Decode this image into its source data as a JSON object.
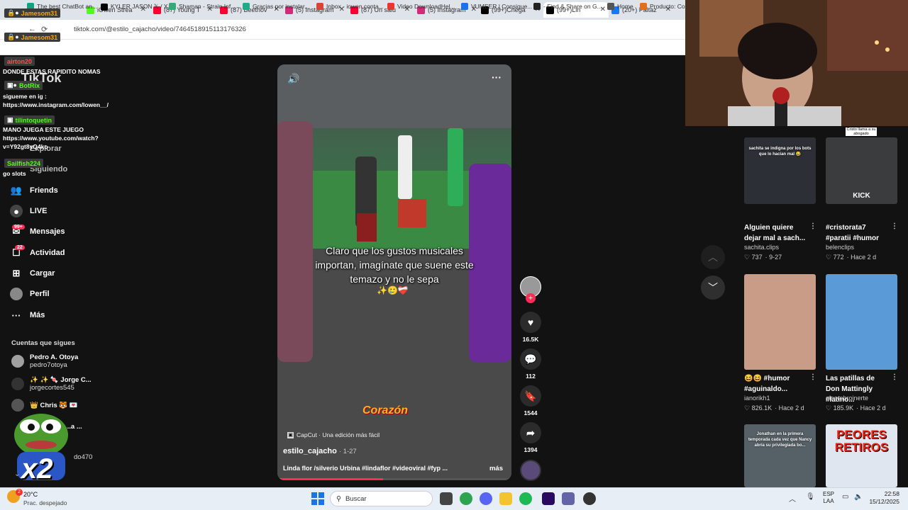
{
  "tabs": [
    {
      "label": "iOwen Strea",
      "color": "#53fc18"
    },
    {
      "label": "(87) Young T",
      "color": "#ff0033"
    },
    {
      "label": "(87) Beethov",
      "color": "#ff0033"
    },
    {
      "label": "(5) Instagram",
      "color": "#d62976"
    },
    {
      "label": "(87) Un salu",
      "color": "#ff0033"
    },
    {
      "label": "(5) Instagram",
      "color": "#d62976"
    },
    {
      "label": "(99+)Chega",
      "color": "#000000"
    },
    {
      "label": "(99+)Lin",
      "color": "#000000"
    },
    {
      "label": "(20+) Paltaz",
      "color": "#1877f2"
    }
  ],
  "url": "tiktok.com/@estilo_cajacho/video/7464518915113176326",
  "bookmarks": [
    {
      "label": "The best ChatBot an..."
    },
    {
      "label": "KYLER JASON 𝕏 / X"
    },
    {
      "label": "Shaman - Strain Inf..."
    },
    {
      "label": "Gracias por instalar..."
    },
    {
      "label": "Inbox - iowen.conta..."
    },
    {
      "label": "Video DownloadHel..."
    },
    {
      "label": "VUMEER | Consigue..."
    },
    {
      "label": "- Find & Share on G..."
    },
    {
      "label": "Home"
    },
    {
      "label": "Producto: Coll"
    }
  ],
  "chat": [
    {
      "user": "Jamesom31",
      "color": "#ffa500"
    },
    {
      "user": "Jamesom31",
      "color": "#ffa500"
    },
    {
      "user": "airton20",
      "color": "#ff4d4d"
    },
    {
      "msg": "DONDE ESTAS RAPIDITO NOMAS"
    },
    {
      "user": "BotRix",
      "color": "#53fc18"
    },
    {
      "msg": "sigueme en ig : https://www.instagram.com/lowen__/"
    },
    {
      "user": "tilintoquetin",
      "color": "#53fc18"
    },
    {
      "msg": "MANO JUEGA ESTE JUEGO https://www.youtube.com/watch?v=Y92gt8yQ4ko"
    },
    {
      "user": "Sailfish224",
      "color": "#53fc18"
    },
    {
      "msg": "go slots"
    }
  ],
  "sidebar": {
    "logo": "TikTok",
    "explorar": "Explorar",
    "siguiendo": "Siguiendo",
    "items": [
      {
        "label": "Friends",
        "icon": "friends-icon"
      },
      {
        "label": "LIVE",
        "icon": "live-icon"
      },
      {
        "label": "Mensajes",
        "icon": "messages-icon",
        "badge": "99+"
      },
      {
        "label": "Actividad",
        "icon": "activity-icon",
        "badge": "22"
      },
      {
        "label": "Cargar",
        "icon": "upload-icon"
      },
      {
        "label": "Perfil",
        "icon": "profile-icon"
      },
      {
        "label": "Más",
        "icon": "more-icon"
      }
    ],
    "following_title": "Cuentas que sigues",
    "following": [
      {
        "name": "Pedro A. Otoya",
        "handle": "pedro7otoya"
      },
      {
        "name": "✨ ✨ 🍬 Jorge C...",
        "handle": "jorgecortes545"
      },
      {
        "name": "👑 Chris 🐯 💌",
        "handle": ""
      },
      {
        "name": "...a ...",
        "handle": "do470"
      }
    ],
    "overlay_x2": "x2"
  },
  "video": {
    "caption_overlay": "Claro que los gustos musicales importan, imagínate que suene este temazo y no le sepa",
    "caption_emojis": "✨🥲❤️‍🩹",
    "capcut": "CapCut · Una edición más fácil",
    "author": "estilo_cajacho",
    "date": "· 1-27",
    "description": "Linda flor /silverio Urbina #lindaflor #videoviral #fyp ...",
    "more": "más",
    "sticker_text": "Corazón",
    "progress": 0.45
  },
  "actions": [
    {
      "icon": "heart-icon",
      "count": "16.5K"
    },
    {
      "icon": "comment-icon",
      "count": "112"
    },
    {
      "icon": "bookmark-icon",
      "count": "1544"
    },
    {
      "icon": "share-icon",
      "count": "1394"
    }
  ],
  "webcam": {
    "sign": "Cristo llama a su abogado"
  },
  "recommended": [
    {
      "title": "Alguien quiere dejar mal a sach...",
      "user": "sachita.clips",
      "likes": "♡ 737",
      "date": "· 9-27",
      "thumb": "#2d2f36",
      "overlay": "sachita se indigna por los bots que lo hacían mal 😂"
    },
    {
      "title": "#cristorata7 #paratii #humor",
      "user": "belenclips",
      "likes": "♡ 772",
      "date": "· Hace 2 d",
      "thumb": "#3a3c3e",
      "overlay": "KICK"
    },
    {
      "title": "😆😆 #humor #aguinaldo...",
      "user": "ianorikh1",
      "likes": "♡ 826.1K",
      "date": "· Hace 2 d",
      "thumb": "#c89c86",
      "overlay": ""
    },
    {
      "title": "Las patillas de Don Mattingly #latino...",
      "user": "elcerebroinerte",
      "likes": "♡ 185.9K",
      "date": "· Hace 2 d",
      "thumb": "#5a9ad6",
      "overlay": ""
    },
    {
      "title": "",
      "user": "",
      "likes": "",
      "date": "",
      "thumb": "#556067",
      "overlay": "Jonathan en la primera temporada cada vez que Nancy abría su privilegiada bo..."
    },
    {
      "title": "",
      "user": "",
      "likes": "",
      "date": "",
      "thumb": "#e0e6ef",
      "overlay": "PEORES RETIROS"
    }
  ],
  "taskbar": {
    "weather_temp": "20°C",
    "weather_desc": "Prac. despejado",
    "search": "Buscar",
    "lang1": "ESP",
    "lang2": "LAA",
    "time": "22:58",
    "date": "15/12/2025"
  }
}
